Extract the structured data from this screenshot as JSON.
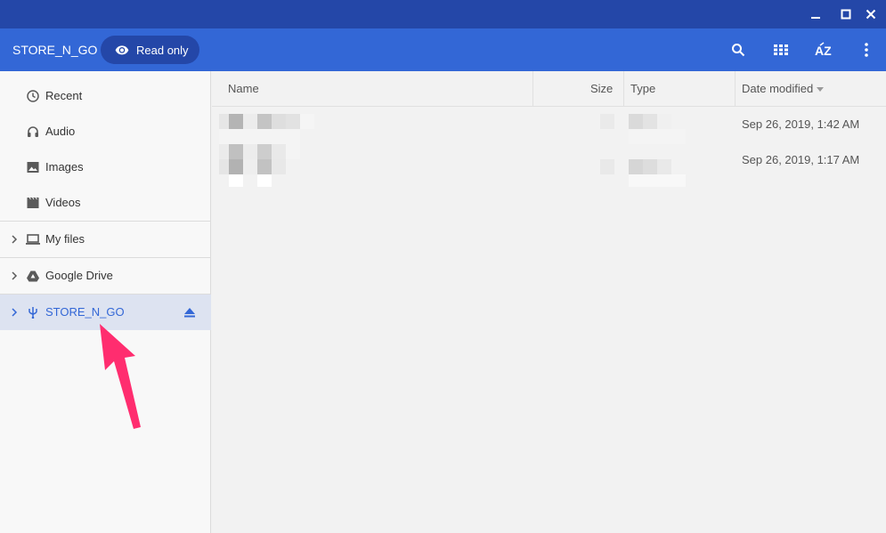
{
  "window": {
    "min_icon": "minimize-icon",
    "max_icon": "maximize-icon",
    "close_icon": "close-icon"
  },
  "toolbar": {
    "title": "STORE_N_GO",
    "read_only_label": "Read only",
    "icons": [
      "search-icon",
      "grid-view-icon",
      "sort-az-icon",
      "more-vert-icon"
    ]
  },
  "sidebar": {
    "items": [
      {
        "label": "Recent",
        "icon": "clock-icon"
      },
      {
        "label": "Audio",
        "icon": "headphones-icon"
      },
      {
        "label": "Images",
        "icon": "image-icon"
      },
      {
        "label": "Videos",
        "icon": "film-icon"
      },
      {
        "label": "My files",
        "icon": "laptop-icon"
      },
      {
        "label": "Google Drive",
        "icon": "drive-icon"
      },
      {
        "label": "STORE_N_GO",
        "icon": "usb-icon"
      }
    ]
  },
  "columns": {
    "name": "Name",
    "size": "Size",
    "type": "Type",
    "date": "Date modified"
  },
  "files": [
    {
      "date": "Sep 26, 2019, 1:42 AM"
    },
    {
      "date": "Sep 26, 2019, 1:17 AM"
    }
  ],
  "colors": {
    "titlebar": "#2447a8",
    "toolbar": "#3367d6",
    "accent": "#3367d6",
    "annotation_arrow": "#ff2d6f"
  }
}
